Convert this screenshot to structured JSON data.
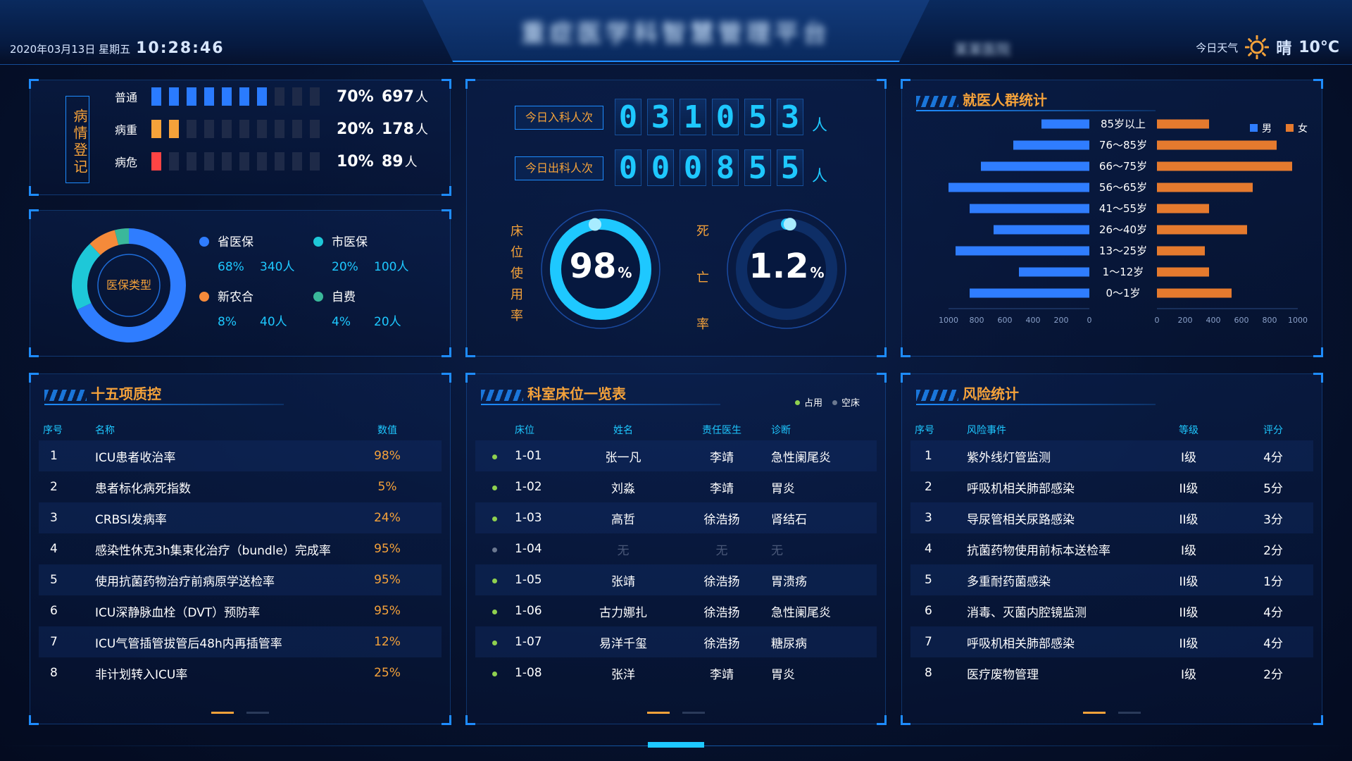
{
  "header": {
    "date": "2020年03月13日 星期五",
    "time": "10:28:46",
    "title": "重症医学科智慧管理平台",
    "hospital": "某某医院",
    "weather_label": "今日天气",
    "weather_icon": "sun-icon",
    "weather_cond": "晴",
    "temperature": "10°C"
  },
  "illness": {
    "box_label": "病情登记",
    "rows": [
      {
        "name": "普通",
        "filled": 7,
        "total": 10,
        "color": "#2a7bff",
        "pct": "70%",
        "count": "697",
        "unit": "人"
      },
      {
        "name": "病重",
        "filled": 2,
        "total": 10,
        "color": "#f5a23a",
        "pct": "20%",
        "count": "178",
        "unit": "人"
      },
      {
        "name": "病危",
        "filled": 1,
        "total": 10,
        "color": "#ff4444",
        "pct": "10%",
        "count": "89",
        "unit": "人"
      }
    ]
  },
  "insurance": {
    "center_label": "医保类型",
    "items": [
      {
        "name": "省医保",
        "pct": "68%",
        "count": "340人",
        "value": 68,
        "color": "#2f7dff"
      },
      {
        "name": "市医保",
        "pct": "20%",
        "count": "100人",
        "value": 20,
        "color": "#1ec8d8"
      },
      {
        "name": "新农合",
        "pct": "8%",
        "count": "40人",
        "value": 8,
        "color": "#f58a3a"
      },
      {
        "name": "自费",
        "pct": "4%",
        "count": "20人",
        "value": 4,
        "color": "#3ab89a"
      }
    ]
  },
  "counters": {
    "in_label": "今日入科人次",
    "in_digits": [
      "0",
      "3",
      "1",
      "0",
      "5",
      "3"
    ],
    "out_label": "今日出科人次",
    "out_digits": [
      "0",
      "0",
      "0",
      "8",
      "5",
      "5"
    ],
    "unit": "人"
  },
  "gauges": {
    "bed_label": [
      "床",
      "位",
      "使",
      "用",
      "率"
    ],
    "bed_value": "98",
    "bed_fraction": 0.98,
    "death_label": [
      "死",
      "亡",
      "率"
    ],
    "death_value": "1.2",
    "death_fraction": 0.012,
    "unit": "%"
  },
  "demographics": {
    "title": "就医人群统计",
    "legend_male": "男",
    "legend_female": "女",
    "male_color": "#2f7dff",
    "female_color": "#e57a2e",
    "axis_ticks_left": [
      "1000",
      "800",
      "600",
      "400",
      "200",
      "0"
    ],
    "axis_ticks_right": [
      "0",
      "200",
      "400",
      "600",
      "800",
      "1000"
    ]
  },
  "chart_data": {
    "type": "bar",
    "categories": [
      "85岁以上",
      "76～85岁",
      "66～75岁",
      "56～65岁",
      "41～55岁",
      "26～40岁",
      "13～25岁",
      "1～12岁",
      "0～1岁"
    ],
    "series": [
      {
        "name": "男",
        "values": [
          340,
          540,
          770,
          1000,
          850,
          680,
          950,
          500,
          850
        ]
      },
      {
        "name": "女",
        "values": [
          370,
          850,
          960,
          680,
          370,
          640,
          340,
          370,
          530
        ]
      }
    ],
    "xlim": [
      0,
      1000
    ],
    "orientation": "horizontal-butterfly"
  },
  "quality": {
    "title": "十五项质控",
    "headers": [
      "序号",
      "名称",
      "数值"
    ],
    "rows": [
      [
        "1",
        "ICU患者收治率",
        "98%"
      ],
      [
        "2",
        "患者标化病死指数",
        "5%"
      ],
      [
        "3",
        "CRBSI发病率",
        "24%"
      ],
      [
        "4",
        "感染性休克3h集束化治疗（bundle）完成率",
        "95%"
      ],
      [
        "5",
        "使用抗菌药物治疗前病原学送检率",
        "95%"
      ],
      [
        "6",
        "ICU深静脉血栓（DVT）预防率",
        "95%"
      ],
      [
        "7",
        "ICU气管插管拔管后48h内再插管率",
        "12%"
      ],
      [
        "8",
        "非计划转入ICU率",
        "25%"
      ]
    ]
  },
  "beds": {
    "title": "科室床位一览表",
    "legend_occupied": "占用",
    "legend_empty": "空床",
    "occupied_color": "#8fd14f",
    "empty_color": "#6b7890",
    "headers": [
      "床位",
      "姓名",
      "责任医生",
      "诊断"
    ],
    "rows": [
      {
        "bed": "1-01",
        "name": "张一凡",
        "doctor": "李靖",
        "diag": "急性阑尾炎",
        "occupied": true
      },
      {
        "bed": "1-02",
        "name": "刘淼",
        "doctor": "李靖",
        "diag": "胃炎",
        "occupied": true
      },
      {
        "bed": "1-03",
        "name": "高哲",
        "doctor": "徐浩扬",
        "diag": "肾结石",
        "occupied": true
      },
      {
        "bed": "1-04",
        "name": "无",
        "doctor": "无",
        "diag": "无",
        "occupied": false
      },
      {
        "bed": "1-05",
        "name": "张靖",
        "doctor": "徐浩扬",
        "diag": "胃溃疡",
        "occupied": true
      },
      {
        "bed": "1-06",
        "name": "古力娜扎",
        "doctor": "徐浩扬",
        "diag": "急性阑尾炎",
        "occupied": true
      },
      {
        "bed": "1-07",
        "name": "易洋千玺",
        "doctor": "徐浩扬",
        "diag": "糖尿病",
        "occupied": true
      },
      {
        "bed": "1-08",
        "name": "张洋",
        "doctor": "李靖",
        "diag": "胃炎",
        "occupied": true
      }
    ]
  },
  "risk": {
    "title": "风险统计",
    "headers": [
      "序号",
      "风险事件",
      "等级",
      "评分"
    ],
    "rows": [
      [
        "1",
        "紫外线灯管监测",
        "I级",
        "4分"
      ],
      [
        "2",
        "呼吸机相关肺部感染",
        "II级",
        "5分"
      ],
      [
        "3",
        "导尿管相关尿路感染",
        "II级",
        "3分"
      ],
      [
        "4",
        "抗菌药物使用前标本送检率",
        "I级",
        "2分"
      ],
      [
        "5",
        "多重耐药菌感染",
        "II级",
        "1分"
      ],
      [
        "6",
        "消毒、灭菌内腔镜监测",
        "II级",
        "4分"
      ],
      [
        "7",
        "呼吸机相关肺部感染",
        "II级",
        "4分"
      ],
      [
        "8",
        "医疗废物管理",
        "I级",
        "2分"
      ]
    ]
  }
}
